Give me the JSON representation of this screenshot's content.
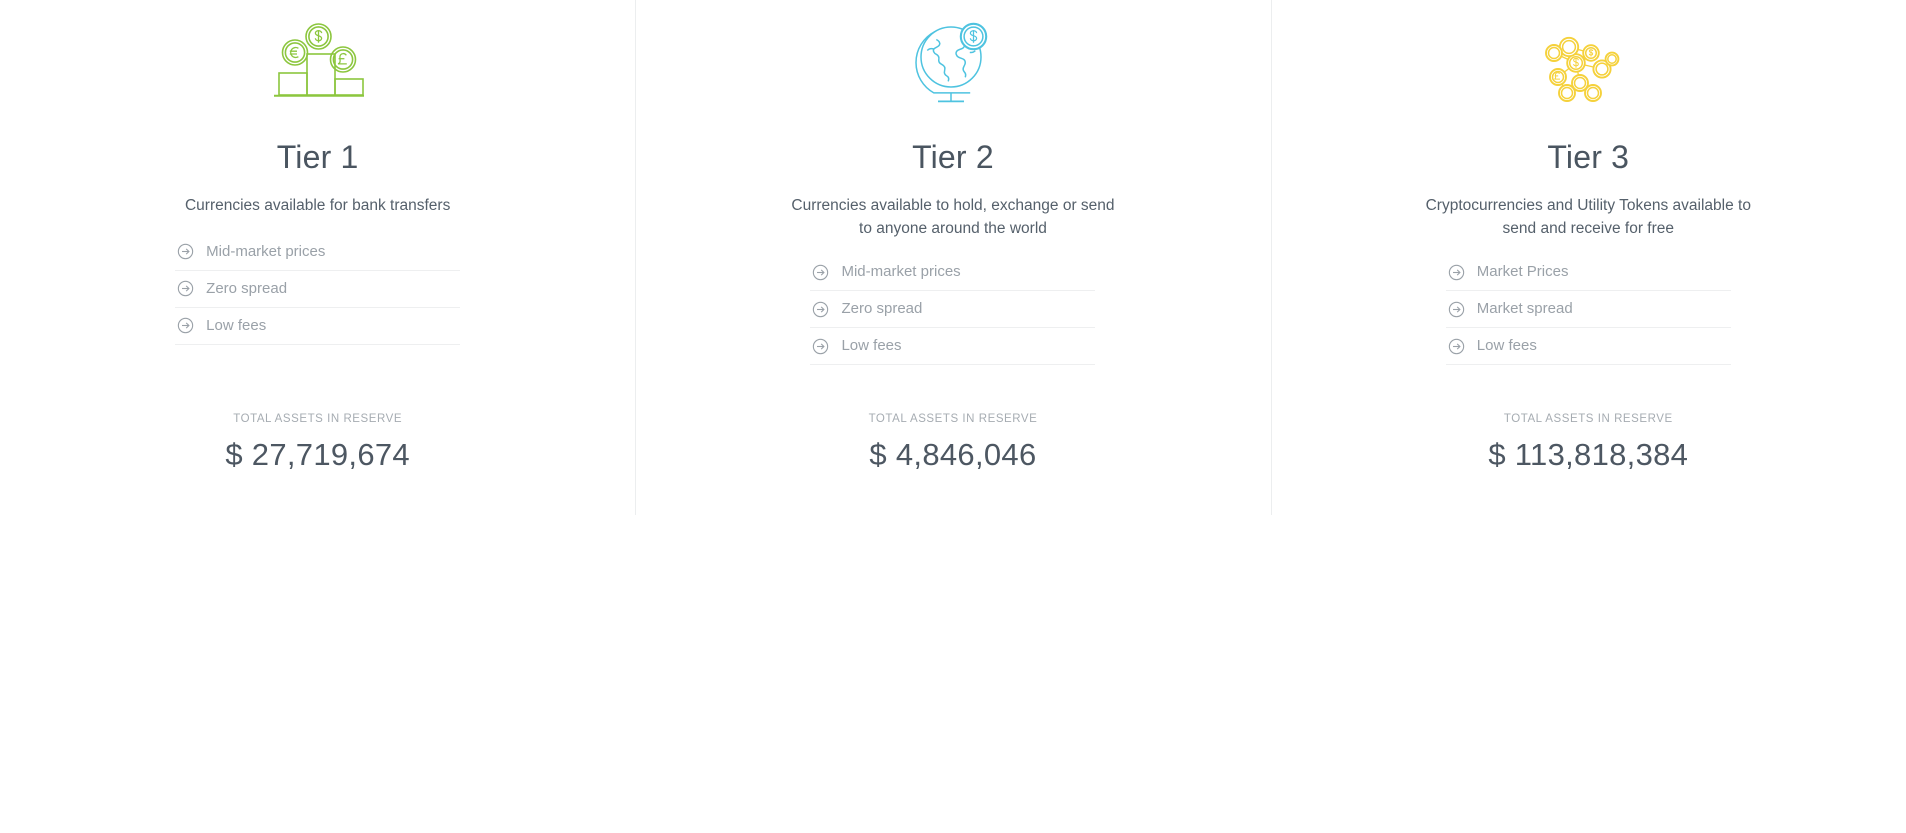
{
  "columns": [
    {
      "icon_name": "podium-coins-icon",
      "icon_color": "#8CC63E",
      "title": "Tier 1",
      "subtitle": "Currencies available for bank transfers",
      "features": [
        {
          "icon": "arrow-circle-right-icon",
          "label": "Mid-market prices"
        },
        {
          "icon": "arrow-circle-right-icon",
          "label": "Zero spread"
        },
        {
          "icon": "arrow-circle-right-icon",
          "label": "Low fees"
        }
      ],
      "reserve_label": "TOTAL ASSETS IN RESERVE",
      "reserve_amount": "$ 27,719,674"
    },
    {
      "icon_name": "globe-dollar-icon",
      "icon_color": "#4EC3E0",
      "title": "Tier 2",
      "subtitle": "Currencies available to hold, exchange or send to anyone around the world",
      "features": [
        {
          "icon": "arrow-circle-right-icon",
          "label": "Mid-market prices"
        },
        {
          "icon": "arrow-circle-right-icon",
          "label": "Zero spread"
        },
        {
          "icon": "arrow-circle-right-icon",
          "label": "Low fees"
        }
      ],
      "reserve_label": "TOTAL ASSETS IN RESERVE",
      "reserve_amount": "$ 4,846,046"
    },
    {
      "icon_name": "crypto-network-icon",
      "icon_color": "#F5D13B",
      "title": "Tier 3",
      "subtitle": "Cryptocurrencies and Utility Tokens available to send and receive for free",
      "features": [
        {
          "icon": "arrow-circle-right-icon",
          "label": "Market Prices"
        },
        {
          "icon": "arrow-circle-right-icon",
          "label": "Market spread"
        },
        {
          "icon": "arrow-circle-right-icon",
          "label": "Low fees"
        }
      ],
      "reserve_label": "TOTAL ASSETS IN RESERVE",
      "reserve_amount": "$ 113,818,384"
    }
  ],
  "theme": {
    "background": "#ffffff",
    "divider": "#eceeef",
    "title_color": "#4a5560",
    "subtitle_color": "#55606b",
    "feature_color": "#9aa1a8",
    "reserve_label_color": "#a6acb2",
    "reserve_amount_color": "#4d5762"
  }
}
